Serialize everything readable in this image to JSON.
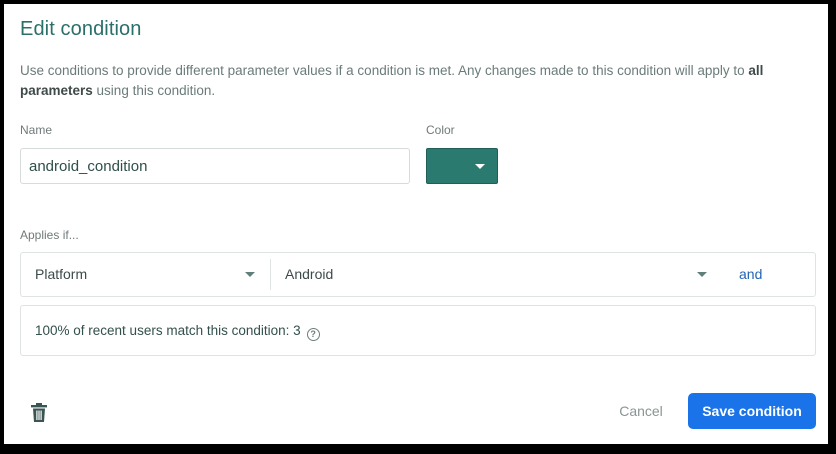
{
  "dialog": {
    "title": "Edit condition",
    "description_pre": "Use conditions to provide different parameter values if a condition is met. Any changes made to this condition will apply to ",
    "description_bold": "all parameters",
    "description_post": " using this condition."
  },
  "name_field": {
    "label": "Name",
    "value": "android_condition"
  },
  "color_field": {
    "label": "Color",
    "value": "#2a7a70"
  },
  "rule": {
    "label": "Applies if...",
    "attribute": "Platform",
    "value": "Android",
    "and_label": "and"
  },
  "match": {
    "text": "100% of recent users match this condition: 3",
    "help_icon": "help-circle-icon"
  },
  "footer": {
    "delete_icon": "trash-icon",
    "cancel_label": "Cancel",
    "save_label": "Save condition"
  }
}
